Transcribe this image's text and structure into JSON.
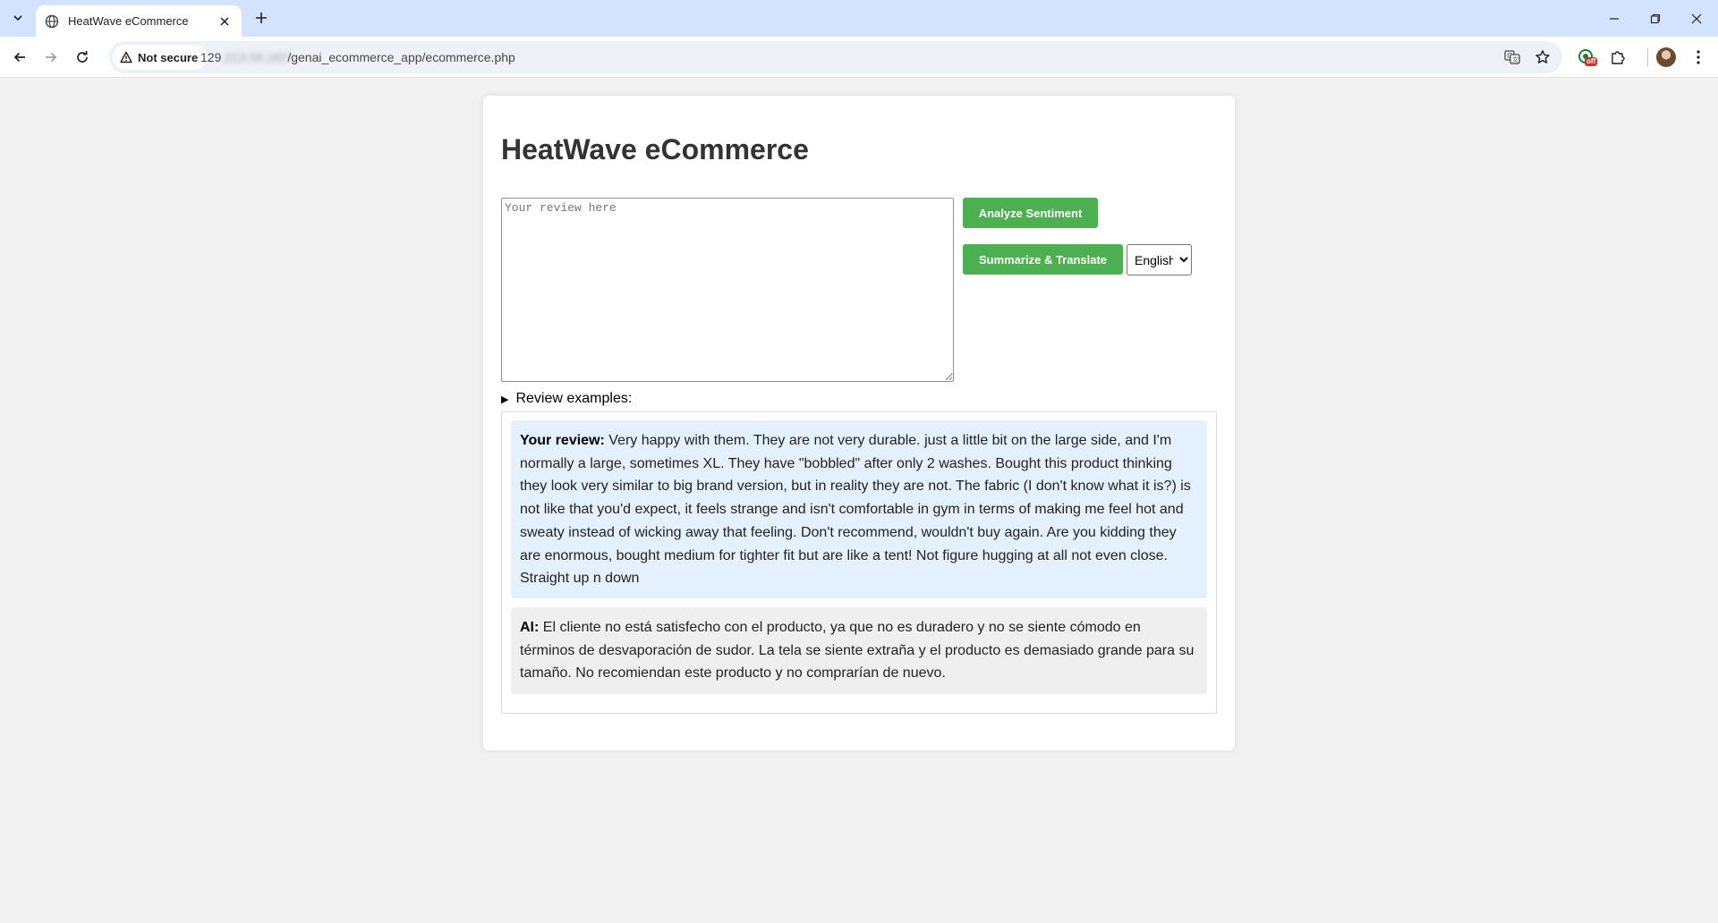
{
  "browser": {
    "tab_title": "HeatWave eCommerce",
    "security_label": "Not secure",
    "url_prefix": "129",
    "url_masked": ".213.56.182",
    "url_path": "/genai_ecommerce_app/ecommerce.php",
    "extension_badge": "off"
  },
  "page": {
    "title": "HeatWave eCommerce",
    "review_placeholder": "Your review here",
    "review_value": "",
    "analyze_label": "Analyze Sentiment",
    "summarize_label": "Summarize & Translate",
    "language_selected": "English",
    "language_options": [
      "English"
    ],
    "examples_label": "Review examples:"
  },
  "conversation": {
    "user_label": "Your review:",
    "user_text": " Very happy with them. They are not very durable. just a little bit on the large side, and I'm normally a large, sometimes XL. They have \"bobbled\" after only 2 washes. Bought this product thinking they look very similar to big brand version, but in reality they are not. The fabric (I don't know what it is?) is not like that you'd expect, it feels strange and isn't comfortable in gym in terms of making me feel hot and sweaty instead of wicking away that feeling. Don't recommend, wouldn't buy again. Are you kidding they are enormous, bought medium for tighter fit but are like a tent! Not figure hugging at all not even close. Straight up n down",
    "ai_label": "AI:",
    "ai_text": " El cliente no está satisfecho con el producto, ya que no es duradero y no se siente cómodo en términos de desvaporación de sudor. La tela se siente extraña y el producto es demasiado grande para su tamaño. No recomiendan este producto y no comprarían de nuevo."
  },
  "colors": {
    "button_green": "#4caf50",
    "user_bubble": "#e3f0fd",
    "ai_bubble": "#efefef",
    "page_bg": "#f2f2f2",
    "tabstrip": "#d3e3fd"
  }
}
